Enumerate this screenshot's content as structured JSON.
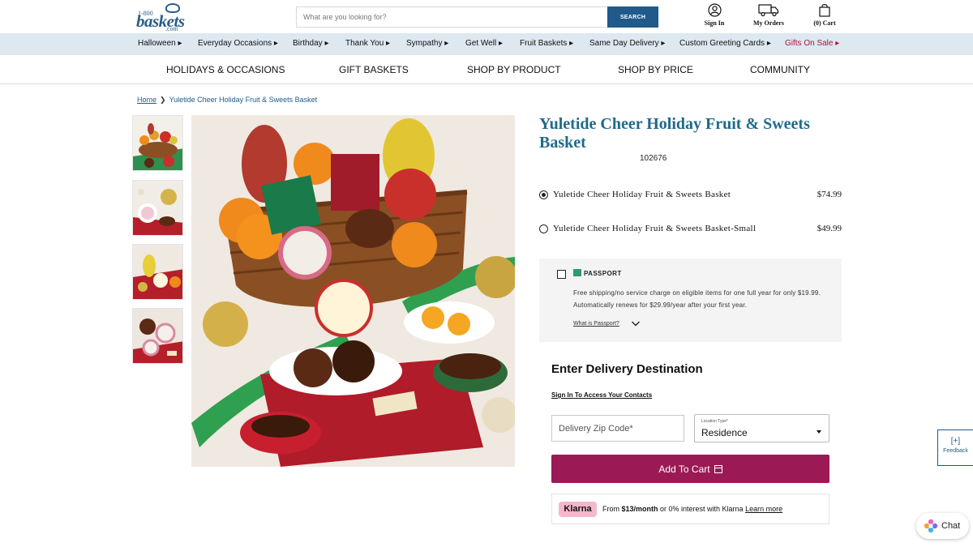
{
  "header": {
    "logo": {
      "line1": "1-800",
      "line2": "baskets",
      "line3": ".com"
    },
    "search": {
      "placeholder": "What are you looking for?",
      "button_label": "SEARCH"
    },
    "sign_in_label": "Sign In",
    "orders_label": "My Orders",
    "cart_label": "(0) Cart"
  },
  "category_bar": [
    {
      "label": "Halloween ▸"
    },
    {
      "label": "Everyday Occasions ▸"
    },
    {
      "label": "Birthday ▸"
    },
    {
      "label": "Thank You ▸"
    },
    {
      "label": "Sympathy ▸"
    },
    {
      "label": "Get Well ▸"
    },
    {
      "label": "Fruit Baskets ▸"
    },
    {
      "label": "Same Day Delivery ▸"
    },
    {
      "label": "Custom Greeting Cards ▸"
    },
    {
      "label": "Gifts On Sale ▸"
    }
  ],
  "main_nav": [
    {
      "label": "HOLIDAYS & OCCASIONS"
    },
    {
      "label": "GIFT BASKETS"
    },
    {
      "label": "SHOP BY PRODUCT"
    },
    {
      "label": "SHOP BY PRICE"
    },
    {
      "label": "COMMUNITY"
    }
  ],
  "breadcrumb": {
    "home": "Home",
    "separator": "❯",
    "current": "Yuletide Cheer Holiday Fruit & Sweets Basket"
  },
  "product": {
    "title": "Yuletide Cheer Holiday Fruit & Sweets Basket",
    "sku": "102676",
    "options": [
      {
        "name": "Yuletide Cheer Holiday Fruit & Sweets Basket",
        "price": "$74.99",
        "selected": true
      },
      {
        "name": "Yuletide Cheer Holiday Fruit & Sweets Basket-Small",
        "price": "$49.99",
        "selected": false
      }
    ]
  },
  "passport": {
    "label": "PASSPORT",
    "description": "Free shipping/no service charge on eligible items for one full year for only $19.99. Automatically renews for $29.99/year after your first year.",
    "link": "What is Passport?"
  },
  "delivery": {
    "heading": "Enter Delivery Destination",
    "sign_in_link": "Sign In To Access Your Contacts",
    "zip_placeholder": "Delivery Zip Code*",
    "location_label": "Location Type*",
    "location_value": "Residence"
  },
  "add_to_cart_label": "Add To Cart",
  "klarna": {
    "badge": "Klarna",
    "text_prefix": "From ",
    "amount": "$13/month",
    "text_middle": " or 0% interest with Klarna ",
    "learn_more": "Learn more"
  },
  "feedback": {
    "plus": "[+]",
    "label": "Feedback"
  },
  "chat_label": "Chat",
  "colors": {
    "brand_blue": "#1f5a8a",
    "title_teal": "#1f6a8a",
    "cart_button": "#9b1a55",
    "category_bar_bg": "#dde8f1",
    "sale_red": "#b3103f",
    "klarna_pink": "#f6b6cc"
  }
}
